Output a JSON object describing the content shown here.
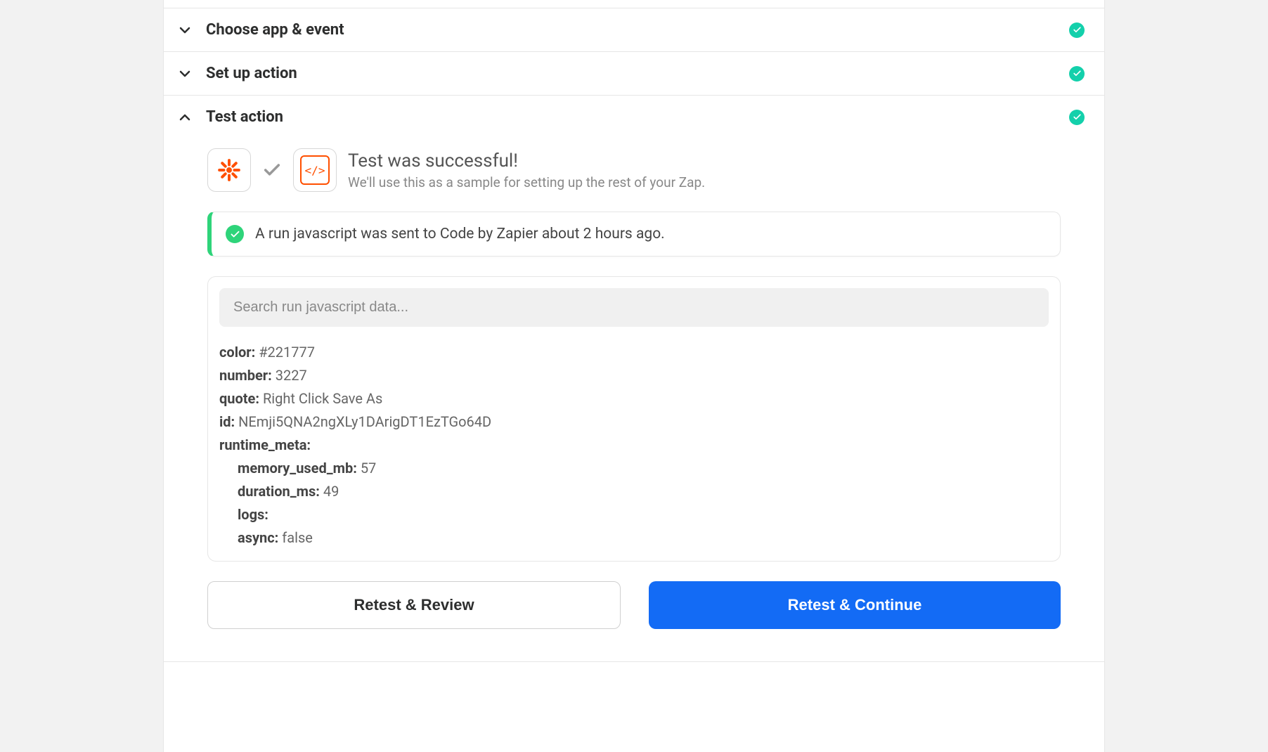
{
  "sections": {
    "choose": {
      "title": "Choose app & event"
    },
    "setup": {
      "title": "Set up action"
    },
    "test": {
      "title": "Test action"
    }
  },
  "success": {
    "heading": "Test was successful!",
    "subtext": "We'll use this as a sample for setting up the rest of your Zap."
  },
  "status": {
    "message": "A run javascript was sent to Code by Zapier about 2 hours ago."
  },
  "search": {
    "placeholder": "Search run javascript data..."
  },
  "result": {
    "fields": {
      "color": "#221777",
      "number": "3227",
      "quote": "Right Click Save As",
      "id": "NEmji5QNA2ngXLy1DArigDT1EzTGo64D"
    },
    "runtime_meta_label": "runtime_meta:",
    "runtime_meta": {
      "memory_used_mb": "57",
      "duration_ms": "49",
      "logs": "",
      "async": "false"
    }
  },
  "buttons": {
    "review": "Retest & Review",
    "continue": "Retest & Continue"
  },
  "labels": {
    "color": "color:",
    "number": "number:",
    "quote": "quote:",
    "id": "id:",
    "memory_used_mb": "memory_used_mb:",
    "duration_ms": "duration_ms:",
    "logs": "logs:",
    "async": "async:"
  }
}
